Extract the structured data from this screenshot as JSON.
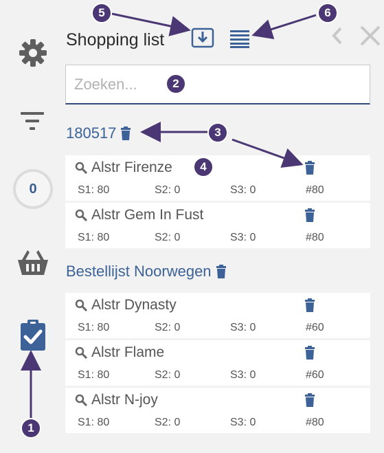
{
  "sidebar": {
    "items": [
      {
        "name": "settings",
        "icon": "gear-icon"
      },
      {
        "name": "filter",
        "icon": "filter-icon"
      },
      {
        "name": "counter",
        "value": "0"
      },
      {
        "name": "basket",
        "icon": "basket-icon"
      },
      {
        "name": "shopping-list",
        "icon": "clipboard-check-icon",
        "active": true
      }
    ]
  },
  "header": {
    "title": "Shopping list",
    "icons": [
      "download-icon",
      "list-icon",
      "chevron-left-icon",
      "close-icon"
    ]
  },
  "search": {
    "placeholder": "Zoeken..."
  },
  "groups": [
    {
      "title": "180517",
      "items": [
        {
          "name": "Alstr Firenze",
          "s1": "S1: 80",
          "s2": "S2: 0",
          "s3": "S3: 0",
          "qty": "#80"
        },
        {
          "name": "Alstr Gem In Fust",
          "s1": "S1: 80",
          "s2": "S2: 0",
          "s3": "S3: 0",
          "qty": "#80"
        }
      ]
    },
    {
      "title": "Bestellijst Noorwegen",
      "items": [
        {
          "name": "Alstr Dynasty",
          "s1": "S1: 80",
          "s2": "S2: 0",
          "s3": "S3: 0",
          "qty": "#60"
        },
        {
          "name": "Alstr Flame",
          "s1": "S1: 80",
          "s2": "S2: 0",
          "s3": "S3: 0",
          "qty": "#60"
        },
        {
          "name": "Alstr N-joy",
          "s1": "S1: 80",
          "s2": "S2: 0",
          "s3": "S3: 0",
          "qty": "#80"
        }
      ]
    }
  ],
  "annotations": [
    "1",
    "2",
    "3",
    "4",
    "5",
    "6"
  ],
  "colors": {
    "accent": "#3d6298",
    "annotation": "#4b3773",
    "icon_gray": "#5a5a5a"
  }
}
